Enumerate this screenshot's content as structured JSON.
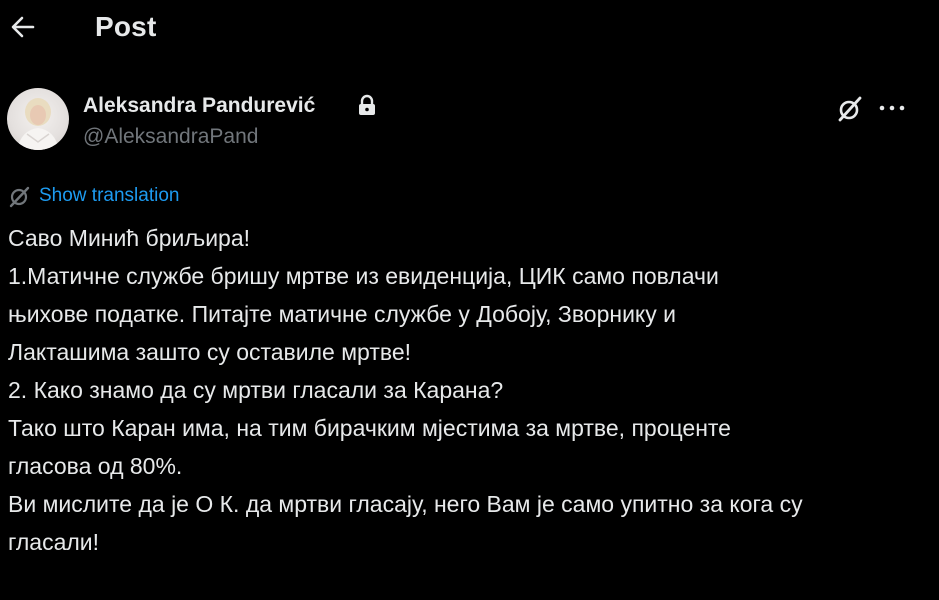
{
  "header": {
    "title": "Post",
    "back_icon": "arrow-left-icon"
  },
  "author": {
    "name": "Aleksandra Pandurević",
    "handle": "@AleksandraPand",
    "lock_icon": "lock-icon",
    "avatar": "profile-avatar"
  },
  "actions": {
    "grok_icon": "grok-icon",
    "more_icon": "more-dots-icon"
  },
  "translate": {
    "label": "Show translation",
    "icon": "translate-icon"
  },
  "post": {
    "lines": [
      "Саво Минић бриљира!",
      "1.Матичне службе бришу мртве из евиденција, ЦИК само повлачи",
      "њихове податке. Питајте матичне службе у Добоју, Зворнику и",
      "Лакташима зашто су оставиле мртве!",
      "2. Како знамо да су мртви гласали за Карана?",
      "Тако што Каран има, на тим бирачким мјестима за мртве, проценте",
      "гласова од 80%.",
      "Ви мислите да је О К. да мртви гласају, него Вам је само упитно за кога су",
      "гласали!"
    ]
  },
  "colors": {
    "background": "#000000",
    "text": "#e7e9ea",
    "secondary": "#71767b",
    "link": "#1d9bf0"
  }
}
